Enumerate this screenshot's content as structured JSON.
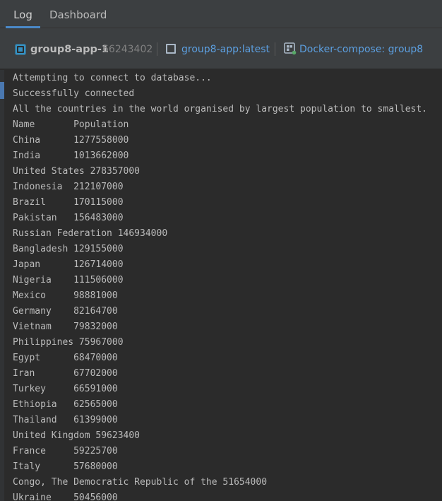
{
  "tabs": {
    "log": "Log",
    "dashboard": "Dashboard"
  },
  "infobar": {
    "container_name": "group8-app-1",
    "container_id": "66243402",
    "image_link": "group8-app:latest",
    "compose_link": "Docker-compose: group8"
  },
  "colors": {
    "accent": "#4a88c7",
    "link": "#5c9fe0",
    "console_bg": "#2b2b2b",
    "console_text": "#bbbbbb"
  },
  "console": {
    "lines": [
      "Attempting to connect to database...",
      "Successfully connected",
      "All the countries in the world organised by largest population to smallest.",
      "Name       Population",
      "China      1277558000",
      "India      1013662000",
      "United States 278357000",
      "Indonesia  212107000",
      "Brazil     170115000",
      "Pakistan   156483000",
      "Russian Federation 146934000",
      "Bangladesh 129155000",
      "Japan      126714000",
      "Nigeria    111506000",
      "Mexico     98881000",
      "Germany    82164700",
      "Vietnam    79832000",
      "Philippines 75967000",
      "Egypt      68470000",
      "Iran       67702000",
      "Turkey     66591000",
      "Ethiopia   62565000",
      "Thailand   61399000",
      "United Kingdom 59623400",
      "France     59225700",
      "Italy      57680000",
      "Congo, The Democratic Republic of the 51654000",
      "Ukraine    50456000"
    ]
  }
}
